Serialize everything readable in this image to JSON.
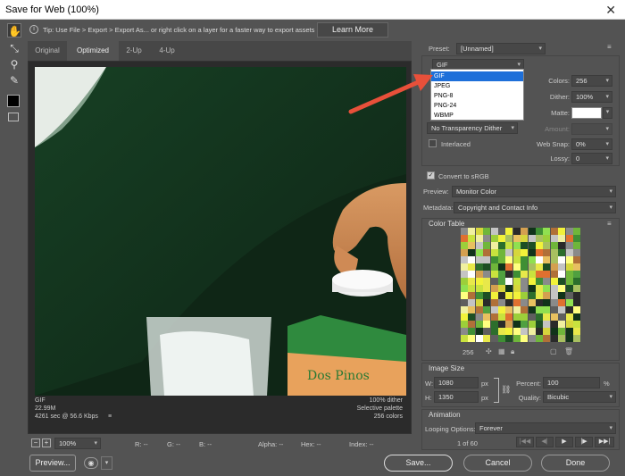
{
  "window": {
    "title": "Save for Web (100%)",
    "close": "✕"
  },
  "tip": {
    "text": "Tip: Use File > Export > Export As...  or right click on a layer for a faster way to export assets",
    "learn_more": "Learn More"
  },
  "tabs": [
    "Original",
    "Optimized",
    "2-Up",
    "4-Up"
  ],
  "preview_info": {
    "format": "GIF",
    "size": "22.99M",
    "time": "4261 sec @ 56.6 Kbps",
    "dither": "100% dither",
    "palette": "Selective palette",
    "colors": "256 colors",
    "menu": "≡"
  },
  "status": {
    "zoom": "100%",
    "r": "R: --",
    "g": "G: --",
    "b": "B: --",
    "alpha": "Alpha: --",
    "hex": "Hex: --",
    "index": "Index: --",
    "minus": "−",
    "plus": "+"
  },
  "buttons": {
    "preview": "Preview...",
    "save": "Save...",
    "cancel": "Cancel",
    "done": "Done"
  },
  "preset": {
    "label": "Preset:",
    "value": "[Unnamed]"
  },
  "format": {
    "value": "GIF",
    "options": [
      "GIF",
      "JPEG",
      "PNG-8",
      "PNG-24",
      "WBMP"
    ],
    "selected": 0
  },
  "settings": {
    "colors_label": "Colors:",
    "colors_value": "256",
    "dither_label": "Dither:",
    "dither_value": "100%",
    "matte_label": "Matte:",
    "amount_label": "Amount:",
    "transparency_dither": "No Transparency Dither",
    "interlaced": "Interlaced",
    "websnap_label": "Web Snap:",
    "websnap_value": "0%",
    "lossy_label": "Lossy:",
    "lossy_value": "0"
  },
  "convert_srgb": "Convert to sRGB",
  "preview_sel": {
    "label": "Preview:",
    "value": "Monitor Color"
  },
  "metadata": {
    "label": "Metadata:",
    "value": "Copyright and Contact Info"
  },
  "color_table": {
    "title": "Color Table",
    "count": "256"
  },
  "image_size": {
    "title": "Image Size",
    "w_label": "W:",
    "w": "1080",
    "h_label": "H:",
    "h": "1350",
    "unit": "px",
    "percent_label": "Percent:",
    "percent": "100",
    "pct": "%",
    "quality_label": "Quality:",
    "quality": "Bicubic"
  },
  "animation": {
    "title": "Animation",
    "looping_label": "Looping Options:",
    "looping": "Forever",
    "frame": "1 of 60"
  },
  "colors": {
    "bg": "#535353",
    "highlight": "#1e6fd9",
    "arrow": "#e8503a"
  },
  "icons": [
    "hand-icon",
    "slice-select-icon",
    "zoom-icon",
    "eyedropper-icon",
    "eyedropper-color-icon",
    "toggle-slices-icon",
    "menu-icon",
    "chevron-down-icon",
    "chain-link-icon"
  ]
}
